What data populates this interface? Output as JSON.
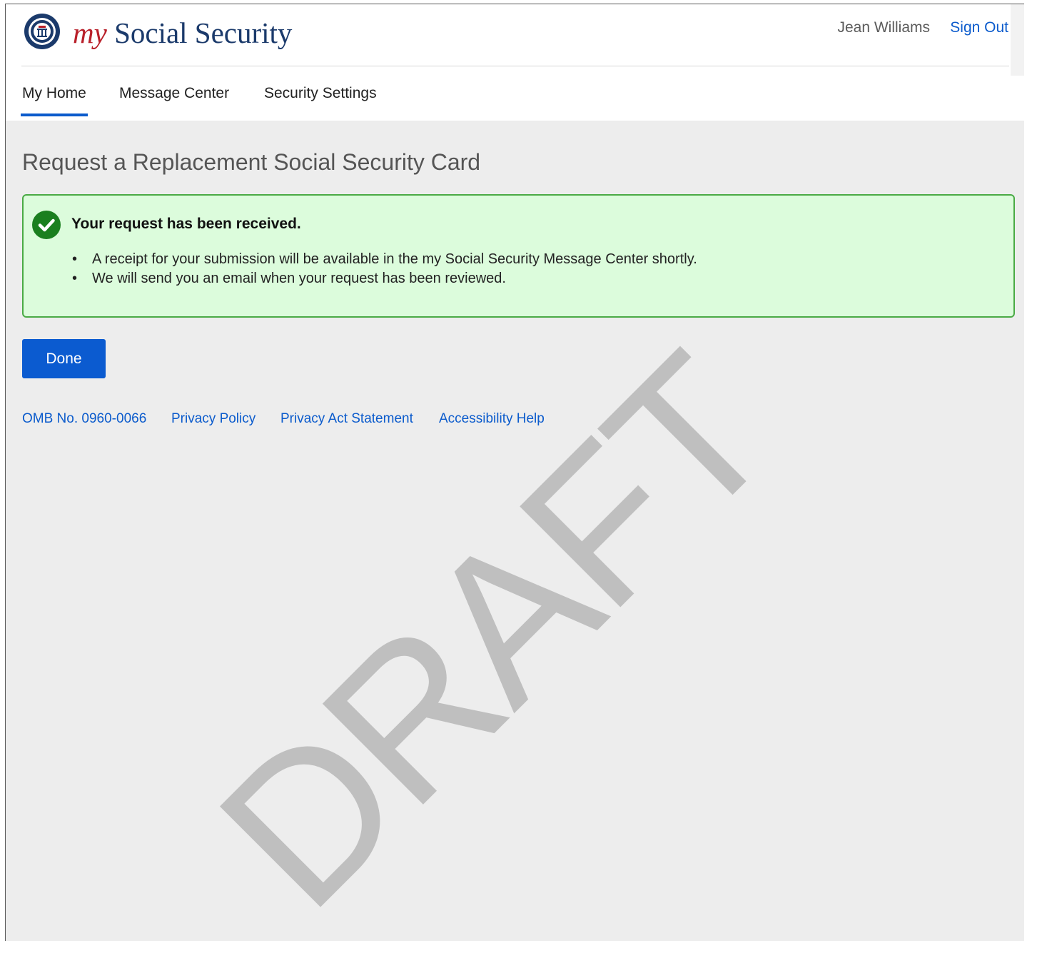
{
  "header": {
    "brand_my": "my",
    "brand_rest": "Social Security",
    "logo_icon": "ssa-seal-icon",
    "user_name": "Jean Williams",
    "sign_out": "Sign Out"
  },
  "nav": {
    "items": [
      {
        "label": "My Home",
        "active": true
      },
      {
        "label": "Message Center",
        "active": false
      },
      {
        "label": "Security Settings",
        "active": false
      }
    ]
  },
  "main": {
    "title": "Request a Replacement Social Security Card",
    "alert": {
      "icon": "check-circle-icon",
      "heading": "Your request has been received.",
      "items": [
        "A receipt for your submission will be available in the my Social Security Message Center shortly.",
        "We will send you an email when your request has been reviewed."
      ]
    },
    "done_label": "Done"
  },
  "footer": {
    "links": [
      "OMB No. 0960-0066",
      "Privacy Policy",
      "Privacy Act Statement",
      "Accessibility Help"
    ]
  },
  "watermark": "DRAFT",
  "colors": {
    "accent_blue": "#0b5bcc",
    "brand_red": "#b9202a",
    "brand_navy": "#1b3a6b",
    "success_green": "#4aaa45",
    "success_bg": "#dcfcdc",
    "page_bg": "#ededed"
  }
}
